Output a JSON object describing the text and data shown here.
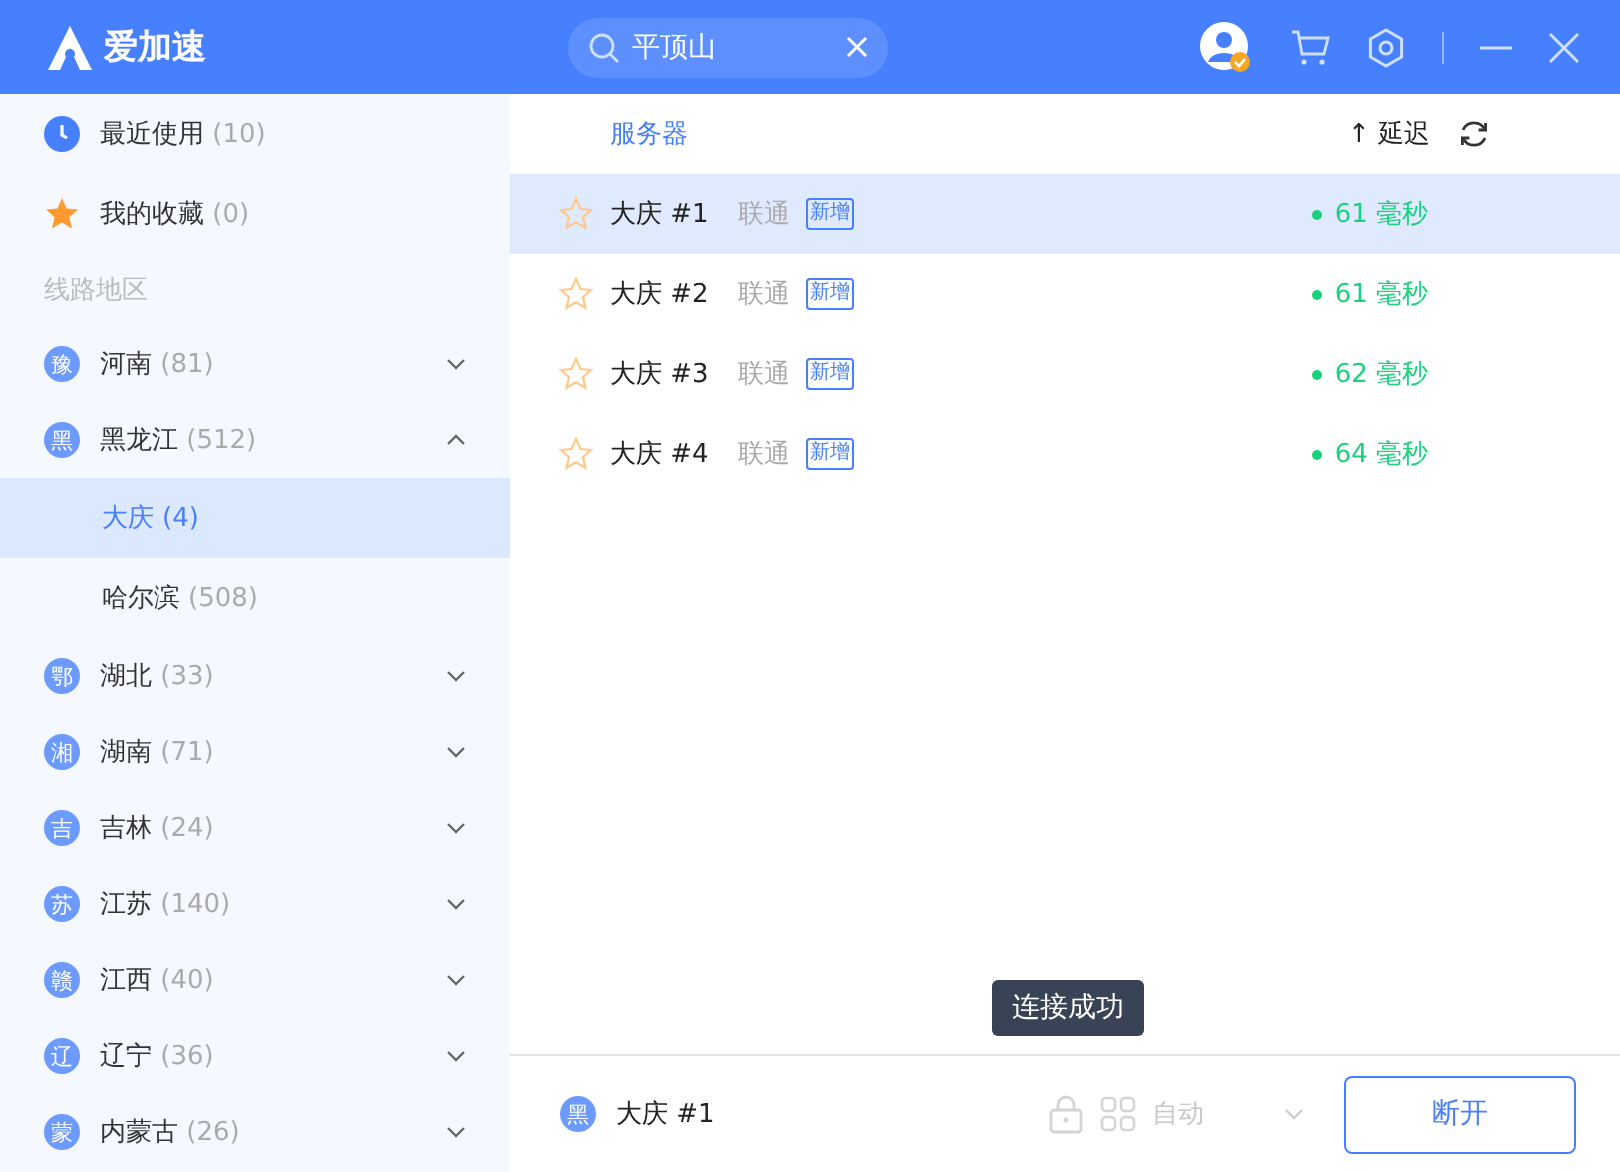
{
  "app": {
    "title": "爱加速"
  },
  "search": {
    "value": "平顶山"
  },
  "sidebar": {
    "quick_items": [
      {
        "kind": "recent",
        "label": "最近使用",
        "count": "(10)"
      },
      {
        "kind": "favorites",
        "label": "我的收藏",
        "count": "(0)"
      }
    ],
    "section_title": "线路地区",
    "regions": [
      {
        "badge": "豫",
        "label": "河南",
        "count": "(81)",
        "expanded": false
      },
      {
        "badge": "黑",
        "label": "黑龙江",
        "count": "(512)",
        "expanded": true,
        "children": [
          {
            "label": "大庆",
            "count": "(4)",
            "selected": true
          },
          {
            "label": "哈尔滨",
            "count": "(508)",
            "selected": false
          }
        ]
      },
      {
        "badge": "鄂",
        "label": "湖北",
        "count": "(33)",
        "expanded": false
      },
      {
        "badge": "湘",
        "label": "湖南",
        "count": "(71)",
        "expanded": false
      },
      {
        "badge": "吉",
        "label": "吉林",
        "count": "(24)",
        "expanded": false
      },
      {
        "badge": "苏",
        "label": "江苏",
        "count": "(140)",
        "expanded": false
      },
      {
        "badge": "赣",
        "label": "江西",
        "count": "(40)",
        "expanded": false
      },
      {
        "badge": "辽",
        "label": "辽宁",
        "count": "(36)",
        "expanded": false
      },
      {
        "badge": "蒙",
        "label": "内蒙古",
        "count": "(26)",
        "expanded": false
      }
    ]
  },
  "server_list": {
    "columns": {
      "server": "服务器",
      "latency": "↑ 延迟"
    },
    "rows": [
      {
        "name": "大庆 #1",
        "isp": "联通",
        "tag": "新增",
        "latency": "61 毫秒",
        "selected": true,
        "favorite": false
      },
      {
        "name": "大庆 #2",
        "isp": "联通",
        "tag": "新增",
        "latency": "61 毫秒",
        "selected": false,
        "favorite": false
      },
      {
        "name": "大庆 #3",
        "isp": "联通",
        "tag": "新增",
        "latency": "62 毫秒",
        "selected": false,
        "favorite": false
      },
      {
        "name": "大庆 #4",
        "isp": "联通",
        "tag": "新增",
        "latency": "64 毫秒",
        "selected": false,
        "favorite": false
      }
    ]
  },
  "toast": "连接成功",
  "footer": {
    "badge": "黑",
    "server": "大庆 #1",
    "mode": "自动",
    "mode_disabled": true,
    "button": "断开"
  }
}
